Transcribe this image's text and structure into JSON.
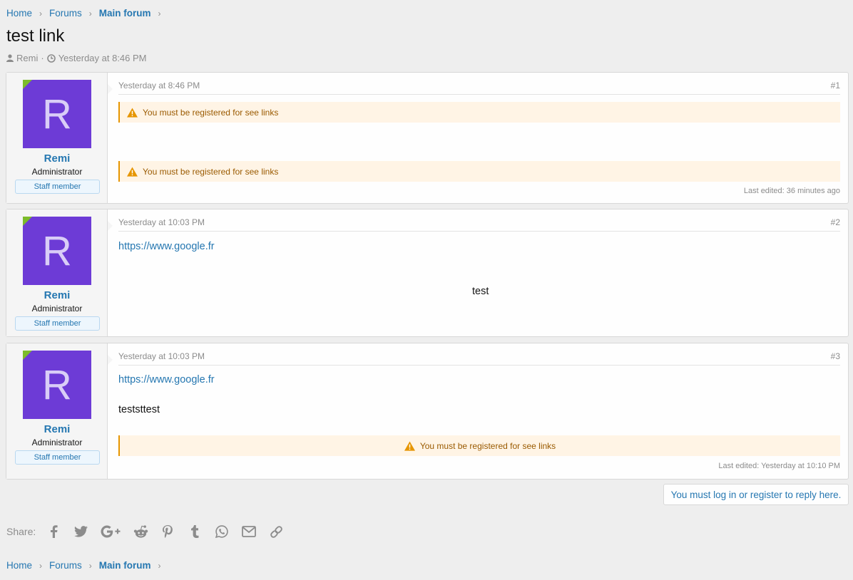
{
  "breadcrumb": {
    "home": "Home",
    "forums": "Forums",
    "main_forum": "Main forum"
  },
  "thread": {
    "title": "test link",
    "author": "Remi",
    "meta_sep": "·",
    "date": "Yesterday at 8:46 PM"
  },
  "posts": [
    {
      "username": "Remi",
      "avatar_letter": "R",
      "user_title": "Administrator",
      "badge": "Staff member",
      "date": "Yesterday at 8:46 PM",
      "number": "#1",
      "notice_1": "You must be registered for see links",
      "notice_2": "You must be registered for see links",
      "last_edited": "Last edited: 36 minutes ago"
    },
    {
      "username": "Remi",
      "avatar_letter": "R",
      "user_title": "Administrator",
      "badge": "Staff member",
      "date": "Yesterday at 10:03 PM",
      "number": "#2",
      "link": "https://www.google.fr",
      "text": "test"
    },
    {
      "username": "Remi",
      "avatar_letter": "R",
      "user_title": "Administrator",
      "badge": "Staff member",
      "date": "Yesterday at 10:03 PM",
      "number": "#3",
      "link": "https://www.google.fr",
      "text": "teststtest",
      "notice_1": "You must be registered for see links",
      "last_edited": "Last edited: Yesterday at 10:10 PM"
    }
  ],
  "reply_prompt": "You must log in or register to reply here.",
  "share": {
    "label": "Share:",
    "icons": [
      "facebook-icon",
      "twitter-icon",
      "google-plus-icon",
      "reddit-icon",
      "pinterest-icon",
      "tumblr-icon",
      "whatsapp-icon",
      "email-icon",
      "link-icon"
    ]
  },
  "colors": {
    "link": "#2577b1",
    "avatar": "#6d3bd6",
    "online": "#7cbb2a",
    "notice_bg": "#fff4e5",
    "notice_border": "#e69500"
  }
}
